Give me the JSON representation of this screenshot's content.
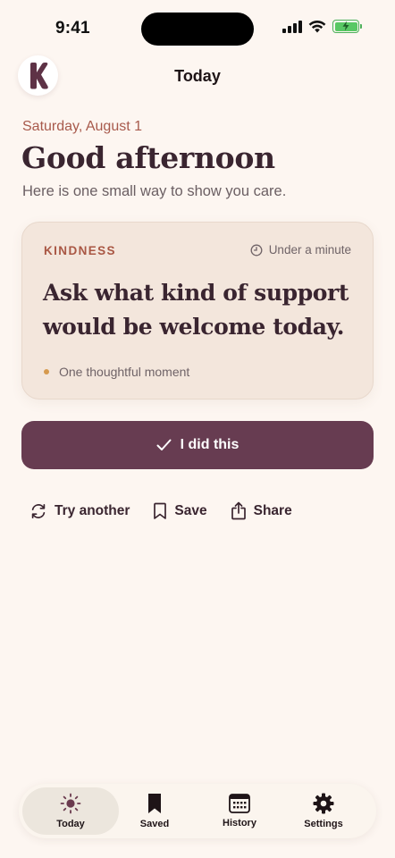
{
  "status_bar": {
    "time": "9:41"
  },
  "header": {
    "title": "Today",
    "logo_icon": "k-logo"
  },
  "date": "Saturday, August 1",
  "greeting": "Good afternoon",
  "subtitle": "Here is one small way to show you care.",
  "card": {
    "category": "KINDNESS",
    "duration": "Under a minute",
    "prompt": "Ask what kind of support would be welcome today.",
    "footer": "One thoughtful moment"
  },
  "primary_action": {
    "label": "I did this",
    "icon": "check-icon"
  },
  "secondary_actions": {
    "try_another": "Try another",
    "save": "Save",
    "share": "Share"
  },
  "tabs": [
    {
      "label": "Today",
      "icon": "sun-icon",
      "active": true
    },
    {
      "label": "Saved",
      "icon": "bookmark-icon",
      "active": false
    },
    {
      "label": "History",
      "icon": "calendar-icon",
      "active": false
    },
    {
      "label": "Settings",
      "icon": "gear-icon",
      "active": false
    }
  ],
  "colors": {
    "background": "#fdf6f1",
    "accent": "#673c51",
    "category": "#a95744",
    "card": "#f3e6dc",
    "battery": "#59c865"
  }
}
